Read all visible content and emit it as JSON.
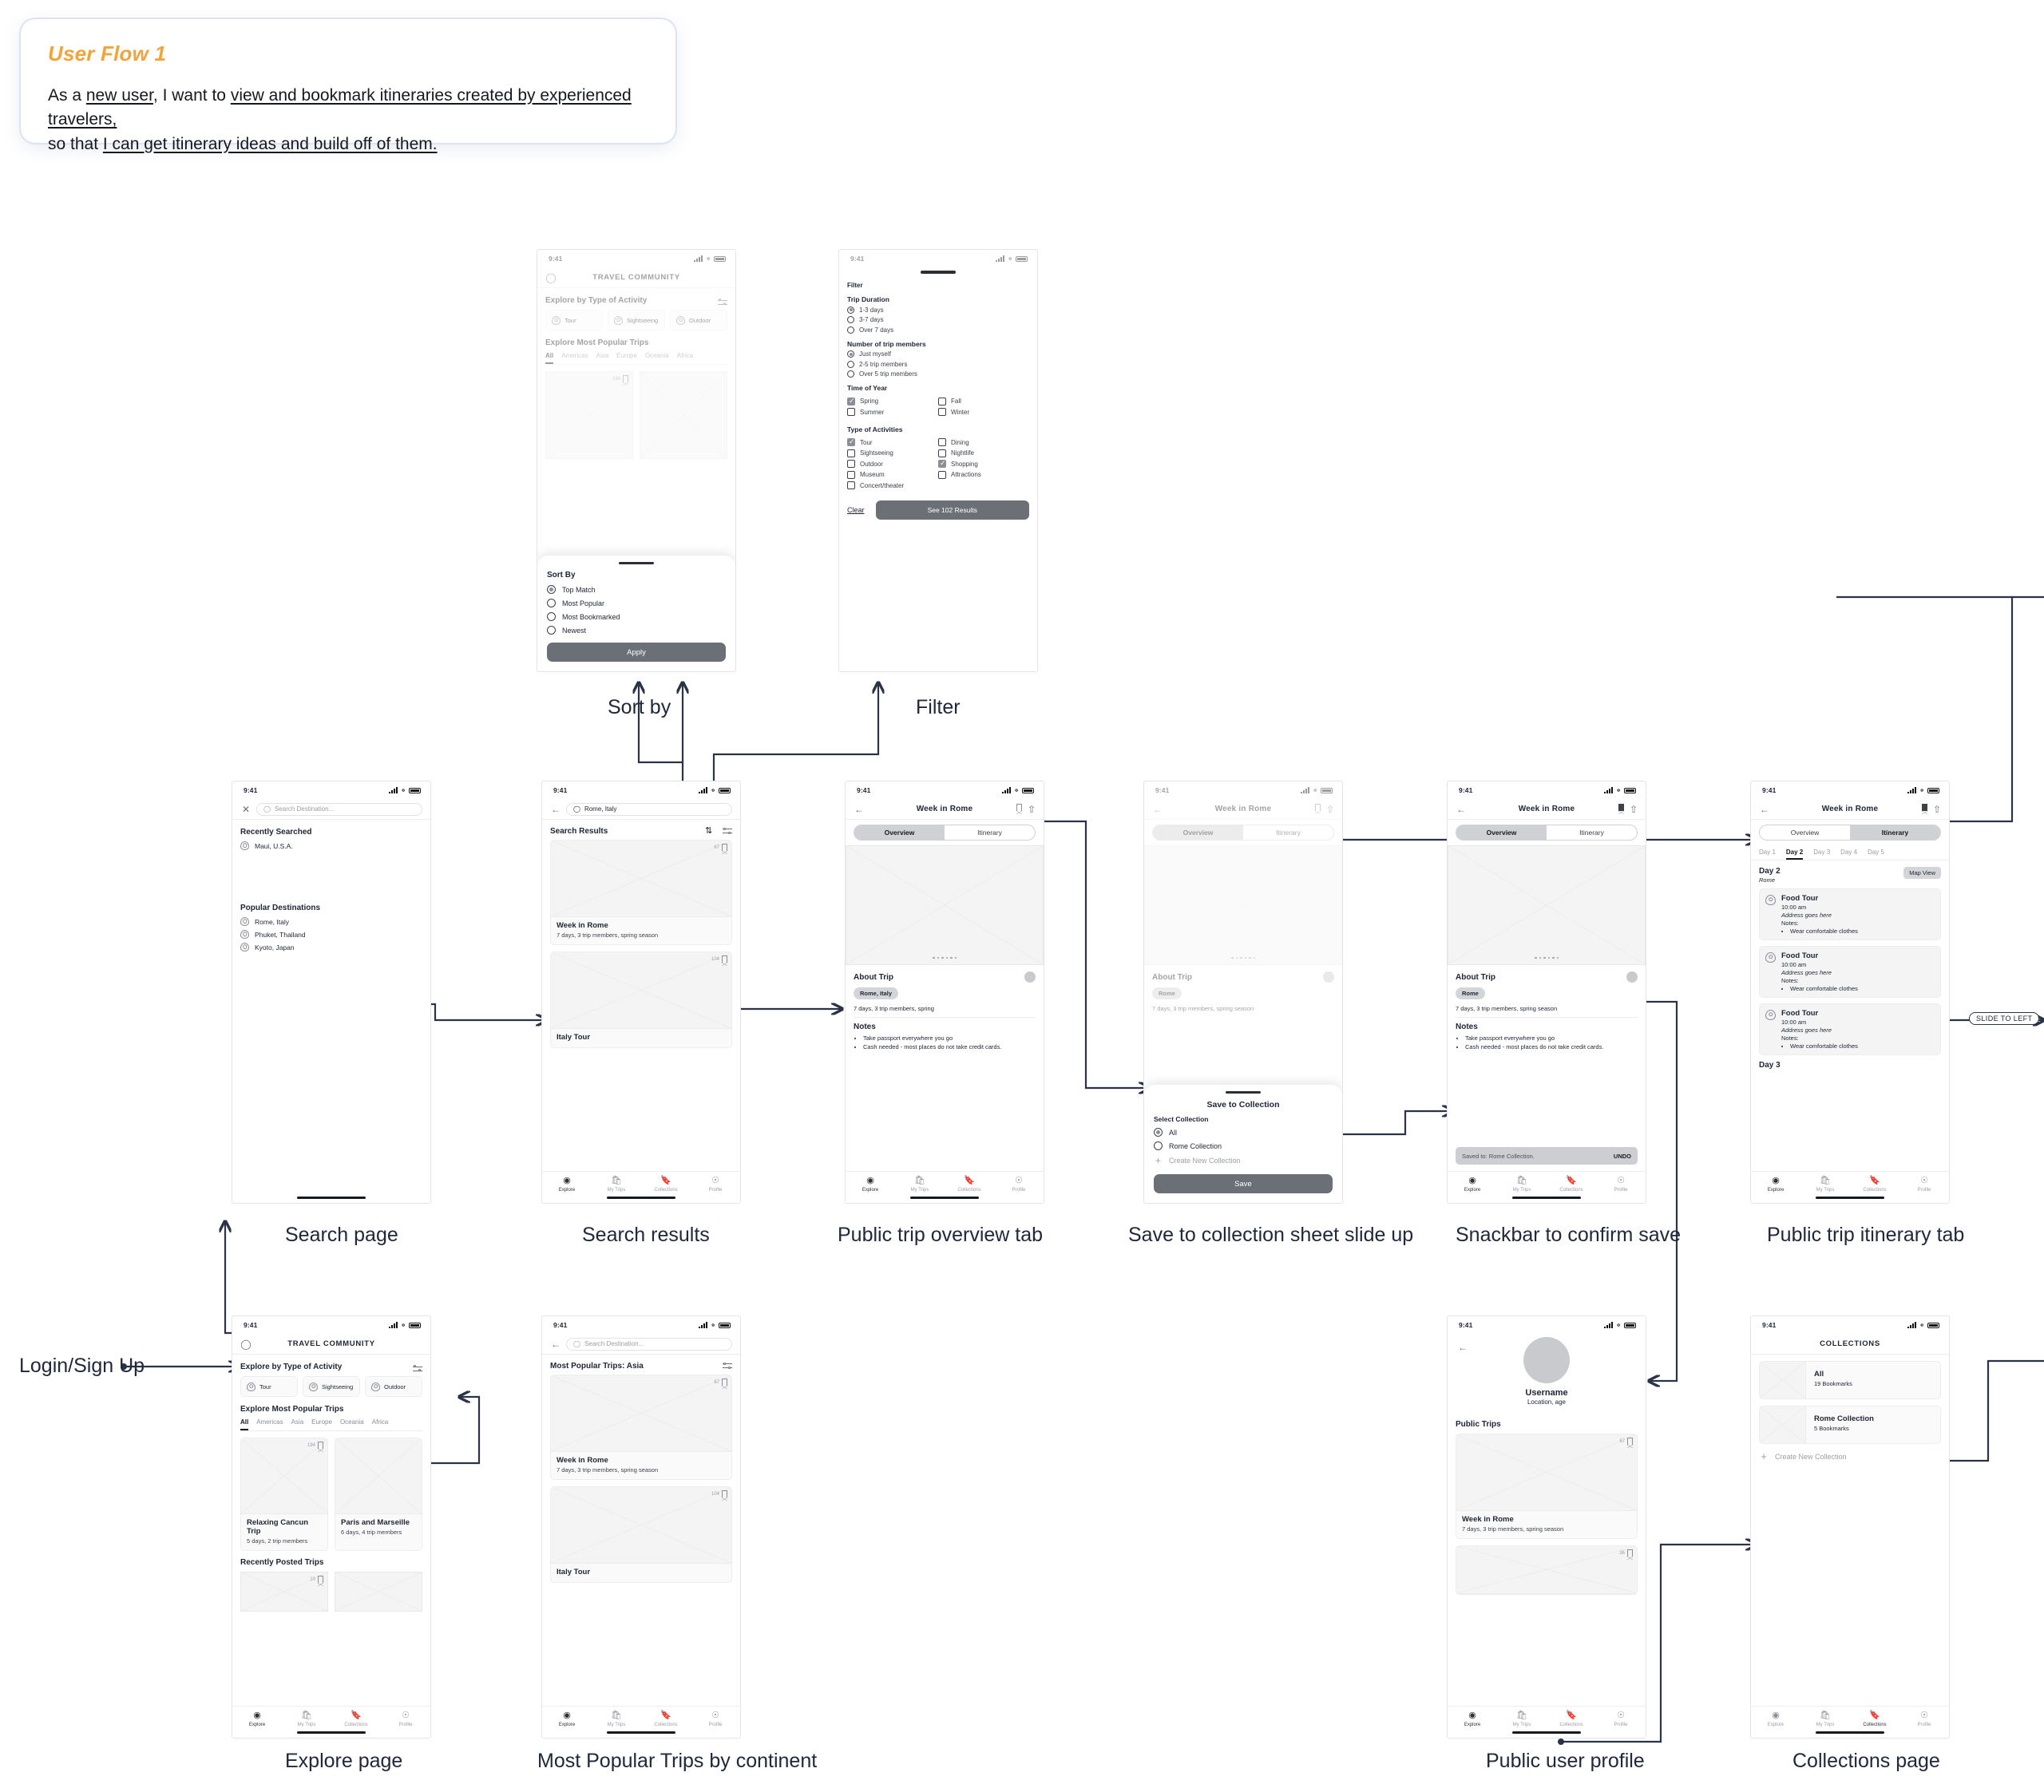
{
  "note": {
    "title": "User Flow 1",
    "line1_pre": "As a ",
    "line1_u1": "new user",
    "line1_mid": ", I want to ",
    "line1_u2": "view and bookmark itineraries created by experienced travelers,",
    "line2_pre": "so that ",
    "line2_u1": "I can get itinerary ideas and build off of them."
  },
  "flow_labels": {
    "sort_by": "Sort by",
    "filter": "Filter",
    "search_page": "Search page",
    "search_results": "Search results",
    "public_trip_overview": "Public trip overview tab",
    "save_sheet": "Save to collection sheet slide up",
    "snackbar": "Snackbar to confirm save",
    "public_trip_itinerary": "Public trip itinerary tab",
    "explore_page": "Explore page",
    "most_popular_continent": "Most Popular Trips by continent",
    "public_user_profile": "Public user profile",
    "collections_page": "Collections page",
    "login_signup": "Login/Sign Up",
    "slide_to_left": "SLIDE TO LEFT"
  },
  "status_bar": {
    "time": "9:41"
  },
  "tabbar": {
    "items": [
      {
        "label": "Explore",
        "icon": "compass-icon"
      },
      {
        "label": "My Trips",
        "icon": "bag-icon"
      },
      {
        "label": "Collections",
        "icon": "bookmark-icon"
      },
      {
        "label": "Profile",
        "icon": "person-icon"
      }
    ]
  },
  "explore": {
    "app_title": "TRAVEL COMMUNITY",
    "section_activity": "Explore by Type of Activity",
    "activity_chips": [
      "Tour",
      "Sightseeing",
      "Outdoor"
    ],
    "section_popular": "Explore Most Popular Trips",
    "continents": [
      "All",
      "Americas",
      "Asia",
      "Europe",
      "Oceania",
      "Africa"
    ],
    "continent_active": "All",
    "cards": [
      {
        "title": "Relaxing Cancun Trip",
        "sub": "5 days, 2 trip members",
        "bookmarks": "194"
      },
      {
        "title": "Paris and Marseille",
        "sub": "6 days, 4 trip members",
        "bookmarks": ""
      }
    ],
    "section_recent": "Recently Posted Trips",
    "recent_bookmarks": "10"
  },
  "sort_sheet": {
    "title": "Sort By",
    "options": [
      "Top Match",
      "Most Popular",
      "Most Bookmarked",
      "Newest"
    ],
    "selected": "Top Match",
    "apply_label": "Apply"
  },
  "filter_sheet": {
    "title": "Filter",
    "groups": [
      {
        "label": "Trip Duration",
        "type": "radio",
        "options": [
          "1-3 days",
          "3-7 days",
          "Over 7 days"
        ],
        "selected": "1-3 days"
      },
      {
        "label": "Number of trip members",
        "type": "radio",
        "options": [
          "Just myself",
          "2-5 trip members",
          "Over 5 trip members"
        ],
        "selected": "Just myself"
      },
      {
        "label": "Time of Year",
        "type": "checkbox",
        "options": [
          "Spring",
          "Fall",
          "Summer",
          "Winter"
        ],
        "checked": [
          "Spring"
        ]
      },
      {
        "label": "Type of Activities",
        "type": "checkbox",
        "options": [
          "Tour",
          "Dining",
          "Sightseeing",
          "Nightlife",
          "Outdoor",
          "Shopping",
          "Museum",
          "Attractions",
          "Concert/theater"
        ],
        "checked": [
          "Tour",
          "Shopping"
        ]
      }
    ],
    "clear_label": "Clear",
    "results_label": "See 102 Results"
  },
  "search_page": {
    "placeholder": "Search Destination...",
    "recent_heading": "Recently Searched",
    "recent": [
      "Maui, U.S.A."
    ],
    "popular_heading": "Popular Destinations",
    "popular": [
      "Rome, Italy",
      "Phuket, Thailand",
      "Kyoto, Japan"
    ]
  },
  "search_results": {
    "query": "Rome, Italy",
    "heading": "Search Results",
    "cards": [
      {
        "title": "Week in Rome",
        "sub": "7 days, 3 trip members, spring season",
        "bookmarks": "67"
      },
      {
        "title": "Italy Tour",
        "sub": "",
        "bookmarks": "104"
      }
    ]
  },
  "continent_results": {
    "placeholder": "Search Destination...",
    "heading": "Most Popular Trips: Asia",
    "cards": [
      {
        "title": "Week in Rome",
        "sub": "7 days, 3 trip members, spring season",
        "bookmarks": "67"
      },
      {
        "title": "Italy Tour",
        "sub": "",
        "bookmarks": "104"
      }
    ]
  },
  "trip": {
    "title": "Week in Rome",
    "tabs": [
      "Overview",
      "Itinerary"
    ],
    "about_heading": "About Trip",
    "tag_full": "Rome, Italy",
    "tag_short": "Rome",
    "summary_short": "7 days, 3 trip members, spring",
    "summary_long": "7 days, 3 trip members, spring season",
    "notes_heading": "Notes",
    "notes": [
      "Take passport everywhere you go",
      "Cash needed - most places do not take credit cards."
    ]
  },
  "save_sheet": {
    "title": "Save to Collection",
    "subtitle": "Select Collection",
    "options": [
      "All",
      "Rome Collection"
    ],
    "selected": "All",
    "create_label": "Create New Collection",
    "save_label": "Save"
  },
  "snackbar": {
    "message": "Saved to: Rome Collection.",
    "action": "UNDO"
  },
  "itinerary": {
    "day_tabs": [
      "Day 1",
      "Day 2",
      "Day 3",
      "Day 4",
      "Day 5"
    ],
    "day_active": "Day 2",
    "day_heading": "Day 2",
    "day_city": "Rome",
    "map_view_label": "Map View",
    "items": [
      {
        "title": "Food Tour",
        "time": "10:00 am",
        "address": "Address goes here",
        "notes_label": "Notes:",
        "note": "Wear comfortable clothes"
      },
      {
        "title": "Food Tour",
        "time": "10:00 am",
        "address": "Address goes here",
        "notes_label": "Notes:",
        "note": "Wear comfortable clothes"
      },
      {
        "title": "Food Tour",
        "time": "10:00 am",
        "address": "Address goes here",
        "notes_label": "Notes:",
        "note": "Wear comfortable clothes"
      }
    ],
    "next_day_heading": "Day 3"
  },
  "profile": {
    "username": "Username",
    "location_age": "Location, age",
    "public_trips_heading": "Public Trips",
    "cards": [
      {
        "title": "Week in Rome",
        "sub": "7 days, 3 trip members, spring season",
        "bookmarks": "67"
      },
      {
        "title": "",
        "sub": "",
        "bookmarks": "36"
      }
    ]
  },
  "collections": {
    "title": "COLLECTIONS",
    "rows": [
      {
        "name": "All",
        "count": "19 Bookmarks"
      },
      {
        "name": "Rome Collection",
        "count": "5 Bookmarks"
      }
    ],
    "create_label": "Create New Collection"
  }
}
